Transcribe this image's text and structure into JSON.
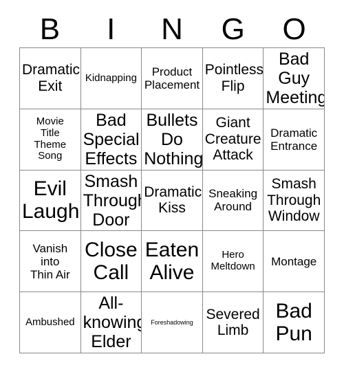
{
  "card": {
    "header_letters": [
      "B",
      "I",
      "N",
      "G",
      "O"
    ],
    "grid_size": 5,
    "border_color": "#888888",
    "background_color": "#ffffff",
    "text_color": "#000000",
    "cells": [
      {
        "text": "Dramatic\nExit",
        "size": "xl"
      },
      {
        "text": "Kidnapping",
        "size": "md"
      },
      {
        "text": "Product\nPlacement",
        "size": "lg"
      },
      {
        "text": "Pointless\nFlip",
        "size": "xl"
      },
      {
        "text": "Bad\nGuy\nMeeting",
        "size": "xxl"
      },
      {
        "text": "Movie\nTitle\nTheme\nSong",
        "size": "md"
      },
      {
        "text": "Bad\nSpecial\nEffects",
        "size": "xxl"
      },
      {
        "text": "Bullets\nDo\nNothing",
        "size": "xxl"
      },
      {
        "text": "Giant\nCreature\nAttack",
        "size": "xl"
      },
      {
        "text": "Dramatic\nEntrance",
        "size": "lg"
      },
      {
        "text": "Evil\nLaugh",
        "size": "huge"
      },
      {
        "text": "Smash\nThrough\nDoor",
        "size": "xxl"
      },
      {
        "text": "Dramatic\nKiss",
        "size": "xl"
      },
      {
        "text": "Sneaking\nAround",
        "size": "lg"
      },
      {
        "text": "Smash\nThrough\nWindow",
        "size": "xl"
      },
      {
        "text": "Vanish\ninto\nThin Air",
        "size": "lg"
      },
      {
        "text": "Close\nCall",
        "size": "huge"
      },
      {
        "text": "Eaten\nAlive",
        "size": "huge"
      },
      {
        "text": "Hero\nMeltdown",
        "size": "md"
      },
      {
        "text": "Montage",
        "size": "lg"
      },
      {
        "text": "Ambushed",
        "size": "md"
      },
      {
        "text": "All-\nknowing\nElder",
        "size": "xxl"
      },
      {
        "text": "Foreshadowing",
        "size": "xs"
      },
      {
        "text": "Severed\nLimb",
        "size": "xl"
      },
      {
        "text": "Bad\nPun",
        "size": "huge"
      }
    ]
  }
}
